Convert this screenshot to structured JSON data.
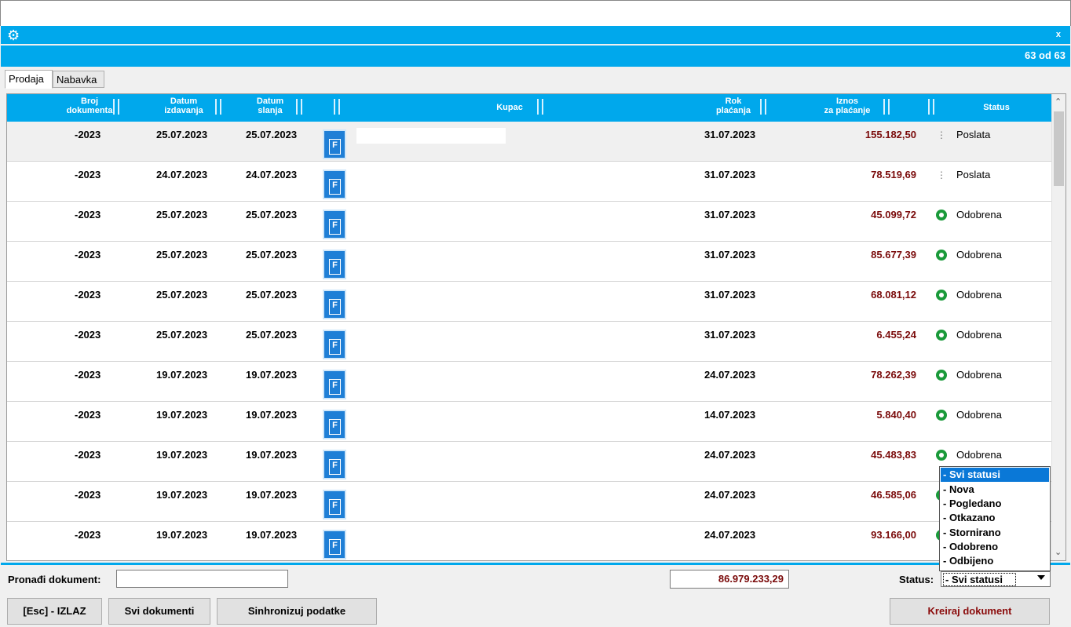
{
  "window": {
    "close_label": "x"
  },
  "counter": "63 od 63",
  "tabs": [
    {
      "label": "Prodaja"
    },
    {
      "label": "Nabavka"
    }
  ],
  "columns": {
    "broj_1": "Broj",
    "broj_2": "dokumenta",
    "datum_izd_1": "Datum",
    "datum_izd_2": "izdavanja",
    "datum_sl_1": "Datum",
    "datum_sl_2": "slanja",
    "kupac": "Kupac",
    "rok_1": "Rok",
    "rok_2": "plaćanja",
    "iznos_1": "Iznos",
    "iznos_2": "za plaćanje",
    "status": "Status"
  },
  "doc_icon_letter": "F",
  "rows": [
    {
      "broj": "-2023",
      "datum_izdavanja": "25.07.2023",
      "datum_slanja": "25.07.2023",
      "kupac": "",
      "rok": "31.07.2023",
      "iznos": "155.182,50",
      "status": "Poslata"
    },
    {
      "broj": "-2023",
      "datum_izdavanja": "24.07.2023",
      "datum_slanja": "24.07.2023",
      "kupac": "",
      "rok": "31.07.2023",
      "iznos": "78.519,69",
      "status": "Poslata"
    },
    {
      "broj": "-2023",
      "datum_izdavanja": "25.07.2023",
      "datum_slanja": "25.07.2023",
      "kupac": "",
      "rok": "31.07.2023",
      "iznos": "45.099,72",
      "status": "Odobrena"
    },
    {
      "broj": "-2023",
      "datum_izdavanja": "25.07.2023",
      "datum_slanja": "25.07.2023",
      "kupac": "",
      "rok": "31.07.2023",
      "iznos": "85.677,39",
      "status": "Odobrena"
    },
    {
      "broj": "-2023",
      "datum_izdavanja": "25.07.2023",
      "datum_slanja": "25.07.2023",
      "kupac": "",
      "rok": "31.07.2023",
      "iznos": "68.081,12",
      "status": "Odobrena"
    },
    {
      "broj": "-2023",
      "datum_izdavanja": "25.07.2023",
      "datum_slanja": "25.07.2023",
      "kupac": "",
      "rok": "31.07.2023",
      "iznos": "6.455,24",
      "status": "Odobrena"
    },
    {
      "broj": "-2023",
      "datum_izdavanja": "19.07.2023",
      "datum_slanja": "19.07.2023",
      "kupac": "",
      "rok": "24.07.2023",
      "iznos": "78.262,39",
      "status": "Odobrena"
    },
    {
      "broj": "-2023",
      "datum_izdavanja": "19.07.2023",
      "datum_slanja": "19.07.2023",
      "kupac": "",
      "rok": "14.07.2023",
      "iznos": "5.840,40",
      "status": "Odobrena"
    },
    {
      "broj": "-2023",
      "datum_izdavanja": "19.07.2023",
      "datum_slanja": "19.07.2023",
      "kupac": "",
      "rok": "24.07.2023",
      "iznos": "45.483,83",
      "status": "Odobrena"
    },
    {
      "broj": "-2023",
      "datum_izdavanja": "19.07.2023",
      "datum_slanja": "19.07.2023",
      "kupac": "",
      "rok": "24.07.2023",
      "iznos": "46.585,06",
      "status": ""
    },
    {
      "broj": "-2023",
      "datum_izdavanja": "19.07.2023",
      "datum_slanja": "19.07.2023",
      "kupac": "",
      "rok": "24.07.2023",
      "iznos": "93.166,00",
      "status": ""
    }
  ],
  "footer": {
    "find_label": "Pronađi dokument:",
    "find_value": "",
    "total": "86.979.233,29",
    "status_label": "Status:",
    "status_selected": "- Svi statusi"
  },
  "status_options": [
    "- Svi statusi",
    "- Nova",
    "- Pogledano",
    "- Otkazano",
    "- Stornirano",
    "- Odobreno",
    "- Odbijeno"
  ],
  "buttons": {
    "exit": "[Esc] - IZLAZ",
    "all_docs": "Svi dokumenti",
    "sync": "Sinhronizuj podatke",
    "create": "Kreiraj dokument"
  },
  "colors": {
    "accent": "#00a8ec",
    "amount": "#7a0a0a",
    "approved": "#1a9a3a",
    "selection": "#0a78d7"
  }
}
